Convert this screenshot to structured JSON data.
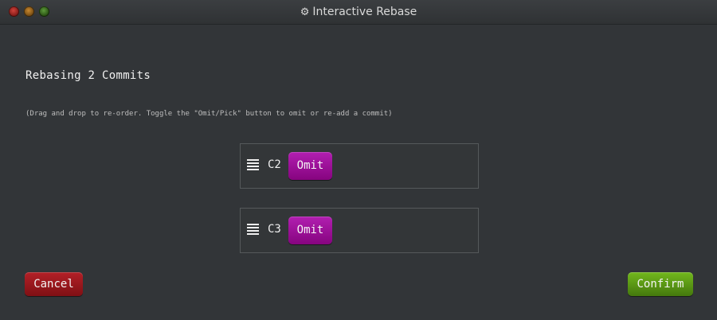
{
  "window": {
    "title": "Interactive Rebase",
    "title_icon": "gear-icon"
  },
  "heading": "Rebasing 2 Commits",
  "hint": "(Drag and drop to re-order. Toggle the \"Omit/Pick\" button to omit or re-add a commit)",
  "commits": [
    {
      "label": "C2",
      "action_label": "Omit"
    },
    {
      "label": "C3",
      "action_label": "Omit"
    }
  ],
  "buttons": {
    "cancel_label": "Cancel",
    "confirm_label": "Confirm"
  },
  "colors": {
    "omit": "#9d0f9a",
    "cancel": "#a0181d",
    "confirm": "#5b9c16",
    "background": "#323538"
  }
}
